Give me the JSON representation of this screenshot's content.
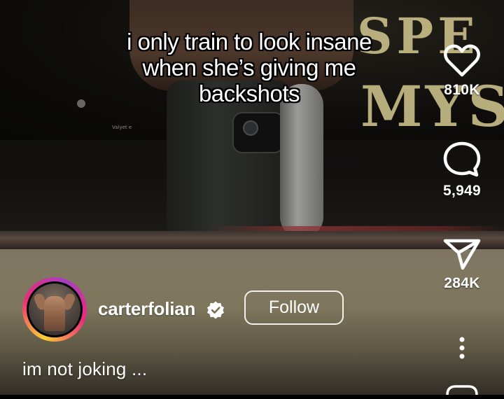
{
  "post": {
    "caption": "i only train to look insane when she’s giving me backshots",
    "description": "im not joking ..."
  },
  "author": {
    "username": "carterfolian",
    "verified": true,
    "follow_label": "Follow"
  },
  "actions": {
    "likes": "810K",
    "comments": "5,949",
    "shares": "284K"
  },
  "background_sign": {
    "line1": "SPE",
    "line2": "MYS"
  },
  "wall_note": "Valyet e",
  "colors": {
    "overlay_text": "#ffffff",
    "avatar_ring_start": "#f9ce34",
    "avatar_ring_mid": "#ee2a7b",
    "verified_badge": "#ffffff",
    "sign_text": "#d4c990"
  },
  "icons": {
    "like": "heart-icon",
    "comment": "comment-bubble-icon",
    "share": "paper-plane-icon",
    "more": "more-vertical-icon",
    "verified": "verified-badge-icon"
  }
}
